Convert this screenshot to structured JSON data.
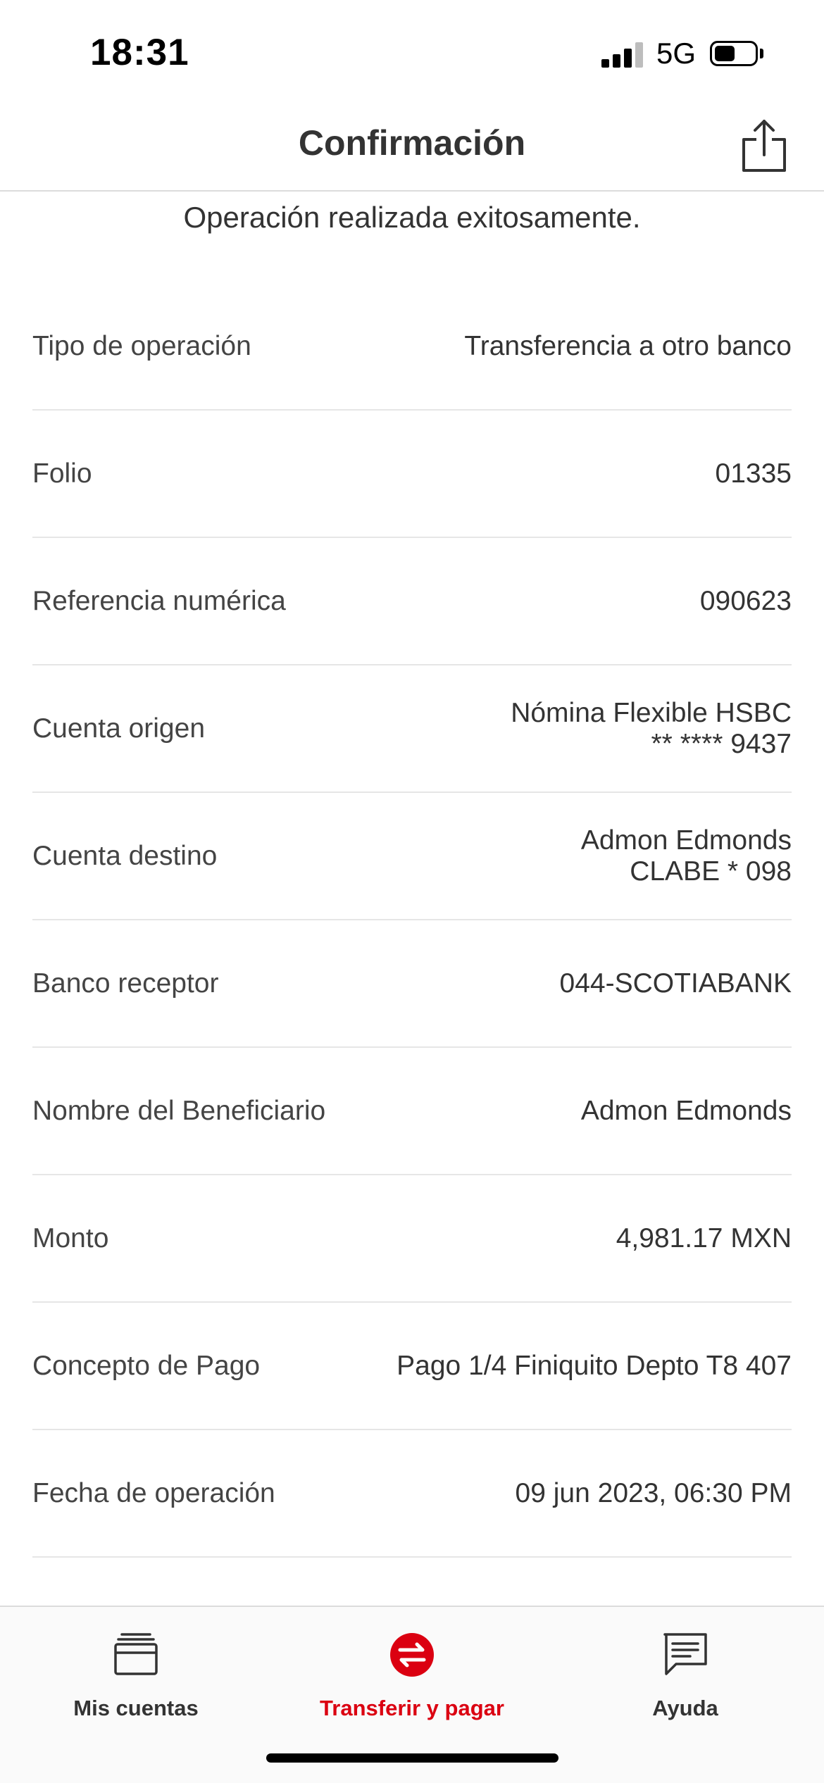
{
  "status_bar": {
    "time": "18:31",
    "network": "5G",
    "battery_level": 0.45
  },
  "header": {
    "title": "Confirmación",
    "share_icon": "share-icon"
  },
  "message": "Operación realizada exitosamente.",
  "details": [
    {
      "label": "Tipo de operación",
      "value": [
        "Transferencia a otro banco"
      ]
    },
    {
      "label": "Folio",
      "value": [
        "01335"
      ]
    },
    {
      "label": "Referencia numérica",
      "value": [
        "090623"
      ]
    },
    {
      "label": "Cuenta origen",
      "value": [
        "Nómina Flexible HSBC",
        "** **** 9437"
      ]
    },
    {
      "label": "Cuenta destino",
      "value": [
        "Admon Edmonds",
        "CLABE * 098"
      ]
    },
    {
      "label": "Banco receptor",
      "value": [
        "044-SCOTIABANK"
      ]
    },
    {
      "label": "Nombre del Beneficiario",
      "value": [
        "Admon Edmonds"
      ]
    },
    {
      "label": "Monto",
      "value": [
        "4,981.17 MXN"
      ]
    },
    {
      "label": "Concepto de Pago",
      "value": [
        "Pago 1/4 Finiquito Depto T8 407"
      ]
    },
    {
      "label": "Fecha de operación",
      "value": [
        "09 jun 2023, 06:30 PM"
      ]
    }
  ],
  "tabs": [
    {
      "label": "Mis cuentas",
      "icon": "wallet-icon",
      "active": false
    },
    {
      "label": "Transferir y pagar",
      "icon": "transfer-icon",
      "active": true
    },
    {
      "label": "Ayuda",
      "icon": "chat-bubble-icon",
      "active": false
    }
  ],
  "colors": {
    "accent": "#db0011",
    "text": "#333333",
    "divider": "#e6e6e6"
  }
}
